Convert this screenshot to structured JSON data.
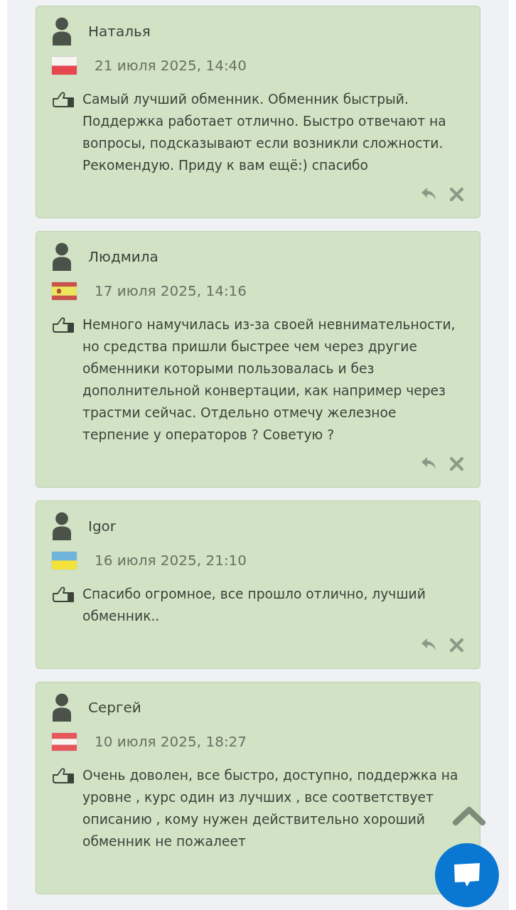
{
  "reviews": [
    {
      "author": "Наталья",
      "flag": {
        "kind": "poland"
      },
      "date": "21 июля 2025, 14:40",
      "text": "Самый лучший обменник. Обменник быстрый. Поддержка работает отлично. Быстро отвечают на вопросы, подсказывают если возникли сложности. Рекомендую. Приду к вам ещё:) спасибо"
    },
    {
      "author": "Людмила",
      "flag": {
        "kind": "spain"
      },
      "date": "17 июля 2025, 14:16",
      "text": "Немного намучилась из-за своей невнимательности, но средства пришли быстрее чем через другие обменники которыми пользовалась и без дополнительной конвертации, как например через трастми сейчас. Отдельно отмечу железное терпение у операторов ? Советую ?"
    },
    {
      "author": "Igor",
      "flag": {
        "kind": "ukraine"
      },
      "date": "16 июля 2025, 21:10",
      "text": "Спасибо огромное, все прошло отлично, лучший обменник.."
    },
    {
      "author": "Сергей",
      "flag": {
        "kind": "austria"
      },
      "date": "10 июля 2025, 18:27",
      "text": "Очень доволен, все быстро, доступно, поддержка на уровне , курс один из лучших , все соответствует описанию , кому нужен действительно хороший обменник не пожалеет"
    }
  ]
}
